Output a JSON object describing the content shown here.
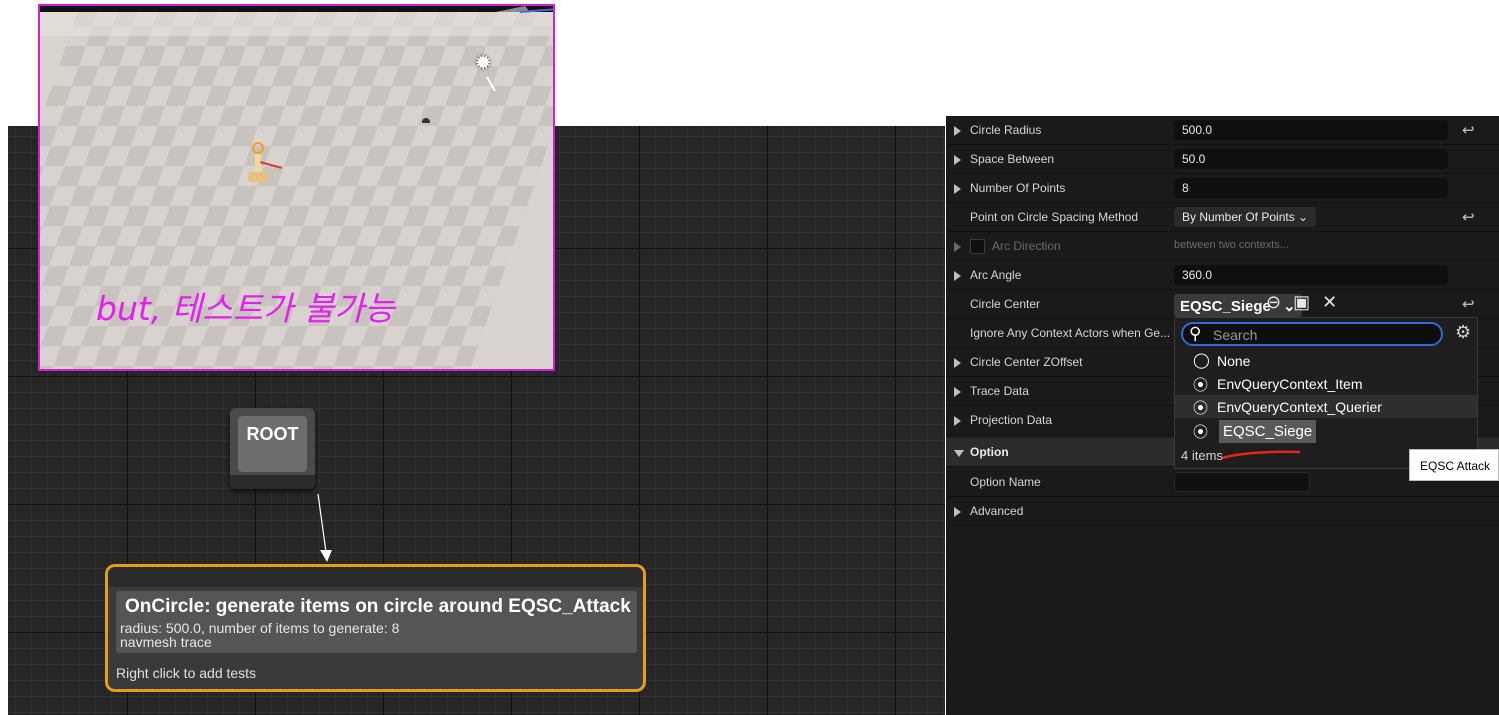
{
  "viewport": {
    "caption": "but, 테스트가 불가능"
  },
  "graph": {
    "root_node": {
      "label": "ROOT"
    },
    "generator_node": {
      "title": "OnCircle: generate items on circle around EQSC_Attack",
      "desc_line1": "radius: 500.0, number of items to generate: 8",
      "desc_line2": "navmesh trace",
      "hint": "Right click to add tests"
    }
  },
  "details": {
    "rows": [
      {
        "name": "Circle Radius",
        "value": "500.0",
        "expandable": true,
        "reset": true
      },
      {
        "name": "Space Between",
        "value": "50.0",
        "expandable": true
      },
      {
        "name": "Number Of Points",
        "value": "8",
        "expandable": true
      },
      {
        "name": "Point on Circle Spacing Method",
        "value": "By Number Of Points ⌄",
        "reset": true
      },
      {
        "name": "Arc Direction",
        "value": "between two contexts...",
        "expandable": true,
        "disabled": true
      },
      {
        "name": "Arc Angle",
        "value": "360.0",
        "expandable": true
      },
      {
        "name": "Circle Center",
        "reset": true
      },
      {
        "name": "Ignore Any Context Actors when Ge..."
      },
      {
        "name": "Circle Center ZOffset",
        "expandable": true
      },
      {
        "name": "Trace Data",
        "expandable": true
      },
      {
        "name": "Projection Data",
        "expandable": true
      },
      {
        "name": "Option",
        "section": true
      },
      {
        "name": "Option Name"
      },
      {
        "name": "Advanced",
        "expandable": true
      }
    ],
    "circle_center_value": "EQSC_Siege",
    "reset_glyph": "↩"
  },
  "dropdown": {
    "search_placeholder": "Search",
    "items": [
      {
        "label": "None",
        "icon": "circle-icon"
      },
      {
        "label": "EnvQueryContext_Item",
        "icon": "context-icon"
      },
      {
        "label": "EnvQueryContext_Querier",
        "icon": "context-icon"
      },
      {
        "label": "EQSC_Siege",
        "icon": "context-icon"
      }
    ],
    "count": "4 items"
  },
  "tooltip": {
    "text": "EQSC Attack"
  },
  "colors": {
    "graph_bg": "#262626",
    "node_border": "#e89d19",
    "viewport_border": "#d21fd6",
    "caption": "#e51ef0",
    "search_border": "#2f6ad8"
  }
}
